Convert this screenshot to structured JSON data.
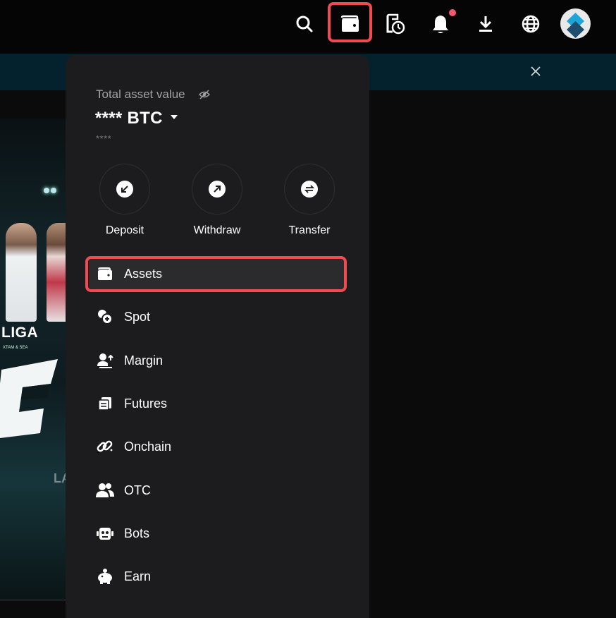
{
  "topbar": {
    "icons": [
      "search-icon",
      "wallet-icon",
      "order-history-icon",
      "bell-icon",
      "download-icon",
      "globe-icon",
      "avatar"
    ],
    "notification_dot_color": "#f2596d",
    "highlight_color": "#ef4b50"
  },
  "banner": {
    "close_icon": "close-icon"
  },
  "promo": {
    "liga_text": "LIGA",
    "sub_text": "XTAM & SEA",
    "la_text": "LA"
  },
  "assets_panel": {
    "total_label": "Total asset value",
    "balance_masked": "**** BTC",
    "sub_balance_masked": "****",
    "actions": [
      {
        "label": "Deposit",
        "icon": "deposit-arrow-icon"
      },
      {
        "label": "Withdraw",
        "icon": "withdraw-arrow-icon"
      },
      {
        "label": "Transfer",
        "icon": "transfer-arrows-icon"
      }
    ],
    "menu": [
      {
        "label": "Assets",
        "icon": "wallet-icon",
        "active": true
      },
      {
        "label": "Spot",
        "icon": "coins-icon"
      },
      {
        "label": "Margin",
        "icon": "margin-icon"
      },
      {
        "label": "Futures",
        "icon": "futures-icon"
      },
      {
        "label": "Onchain",
        "icon": "chain-link-icon"
      },
      {
        "label": "OTC",
        "icon": "people-icon"
      },
      {
        "label": "Bots",
        "icon": "robot-icon"
      },
      {
        "label": "Earn",
        "icon": "piggy-bank-icon"
      }
    ]
  }
}
